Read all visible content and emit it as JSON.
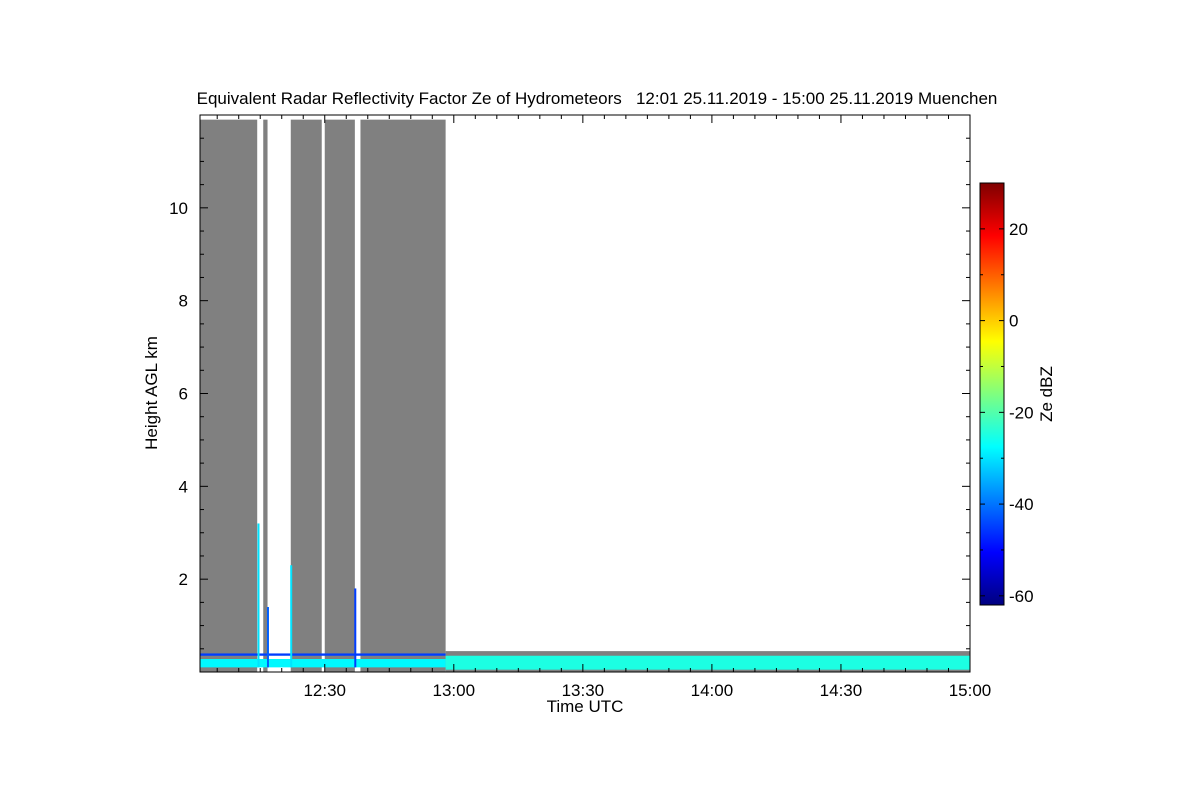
{
  "chart_data": {
    "type": "heatmap",
    "title": "Equivalent Radar Reflectivity Factor Ze of Hydrometeors   12:01 25.11.2019 - 15:00 25.11.2019 Muenchen",
    "xlabel": "Time UTC",
    "ylabel": "Height AGL km",
    "xlim_minutes_utc": [
      721,
      900
    ],
    "ylim_km": [
      0,
      12
    ],
    "x_ticks": [
      {
        "value": 750,
        "label": "12:30"
      },
      {
        "value": 780,
        "label": "13:00"
      },
      {
        "value": 810,
        "label": "13:30"
      },
      {
        "value": 840,
        "label": "14:00"
      },
      {
        "value": 870,
        "label": "14:30"
      },
      {
        "value": 900,
        "label": "15:00"
      }
    ],
    "y_ticks": [
      {
        "value": 2,
        "label": "2"
      },
      {
        "value": 4,
        "label": "4"
      },
      {
        "value": 6,
        "label": "6"
      },
      {
        "value": 8,
        "label": "8"
      },
      {
        "value": 10,
        "label": "10"
      }
    ],
    "colorbar": {
      "label": "Ze dBZ",
      "range": [
        -62,
        30
      ],
      "ticks": [
        {
          "value": -60,
          "label": "-60"
        },
        {
          "value": -40,
          "label": "-40"
        },
        {
          "value": -20,
          "label": "-20"
        },
        {
          "value": 0,
          "label": "0"
        },
        {
          "value": 20,
          "label": "20"
        }
      ],
      "colormap": "jet"
    },
    "no_signal_color": "#808080",
    "no_signal_blocks": [
      {
        "t0": 721,
        "t1": 734.3,
        "h_top": 11.9
      },
      {
        "t0": 735.7,
        "t1": 736.7,
        "h_top": 11.9
      },
      {
        "t0": 742.1,
        "t1": 749.3,
        "h_top": 11.9
      },
      {
        "t0": 750.0,
        "t1": 757.0,
        "h_top": 11.9
      },
      {
        "t0": 758.3,
        "t1": 778.1,
        "h_top": 11.9
      },
      {
        "t0": 778.1,
        "t1": 900,
        "h_top": 0.45
      }
    ],
    "echo_layers": [
      {
        "t0": 721,
        "t1": 778.1,
        "h_bottom": 0.35,
        "h_top": 0.4,
        "dbz": -45
      },
      {
        "t0": 721,
        "t1": 778.1,
        "h_bottom": 0.1,
        "h_top": 0.28,
        "dbz": -28
      },
      {
        "t0": 778.1,
        "t1": 900,
        "h_bottom": 0.05,
        "h_top": 0.35,
        "dbz": -25
      }
    ],
    "echo_streaks": [
      {
        "t": 734.6,
        "h_bottom": 0.1,
        "h_top": 3.2,
        "dbz": -30
      },
      {
        "t": 736.8,
        "h_bottom": 0.1,
        "h_top": 1.4,
        "dbz": -42
      },
      {
        "t": 742.2,
        "h_bottom": 0.1,
        "h_top": 2.3,
        "dbz": -30
      },
      {
        "t": 757.1,
        "h_bottom": 0.1,
        "h_top": 1.8,
        "dbz": -45
      }
    ]
  }
}
